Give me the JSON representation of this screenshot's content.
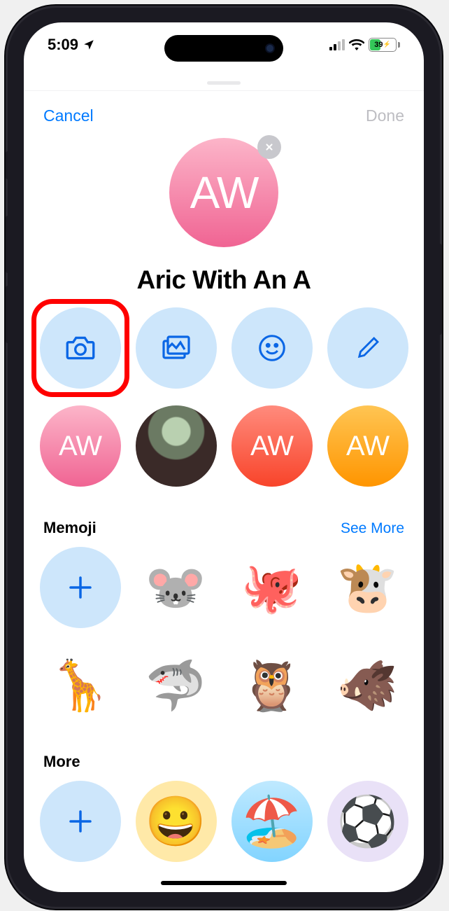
{
  "status": {
    "time": "5:09",
    "battery_percent": "39",
    "battery_fill_pct": 39,
    "signal_bars": 2,
    "signal_total": 4
  },
  "nav": {
    "cancel": "Cancel",
    "done": "Done"
  },
  "avatar": {
    "initials": "AW"
  },
  "contact_name": "Aric With An A",
  "suggestions": {
    "initials": "AW"
  },
  "sections": {
    "memoji": {
      "title": "Memoji",
      "see_more": "See More"
    },
    "more": {
      "title": "More"
    }
  },
  "memoji_items": [
    "🐭",
    "🐙",
    "🐮",
    "🦒",
    "🦈",
    "🦉",
    "🐗"
  ],
  "more_items": [
    "😀",
    "🏖️",
    "⚽"
  ]
}
